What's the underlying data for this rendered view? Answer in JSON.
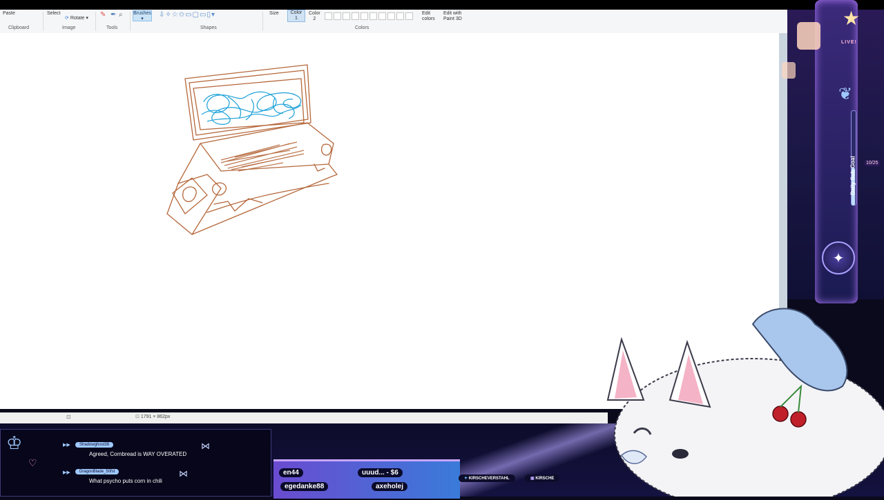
{
  "ribbon": {
    "paste_label": "Paste",
    "select_label": "Select",
    "rotate_label": "Rotate",
    "brushes_label": "Brushes",
    "size_label": "Size",
    "color1_label": "Color",
    "color1_num": "1",
    "color2_label": "Color",
    "color2_num": "2",
    "edit_colors_label": "Edit colors",
    "edit_paint3d_label": "Edit with Paint 3D",
    "groups": {
      "clipboard": "Clipboard",
      "image": "Image",
      "tools": "Tools",
      "shapes": "Shapes",
      "colors": "Colors"
    }
  },
  "status": {
    "dimensions": "1791 × 862px"
  },
  "overlay": {
    "live_label": "LIVE!",
    "subgoal_label": "Daily Sub Goal",
    "subgoal_count": "10/25",
    "subgoal_progress": 0.4
  },
  "chat": [
    {
      "user": "Shadowghost38",
      "message": "Agreed, Cornbread is WAY OVERATED"
    },
    {
      "user": "DragonBlade_50fst",
      "message": "What psycho puts corn in chili"
    }
  ],
  "ticker": {
    "items": [
      "en44",
      "uuud... - $6",
      "egedanke88",
      "axeholej"
    ]
  },
  "socials": {
    "twitter": "KIRSCHEVERSTAHL",
    "twitch": "KIRSCHE"
  },
  "colors": {
    "accent": "#8f7bff",
    "drawing_brown": "#b5673a",
    "drawing_blue": "#1aa0d8"
  }
}
